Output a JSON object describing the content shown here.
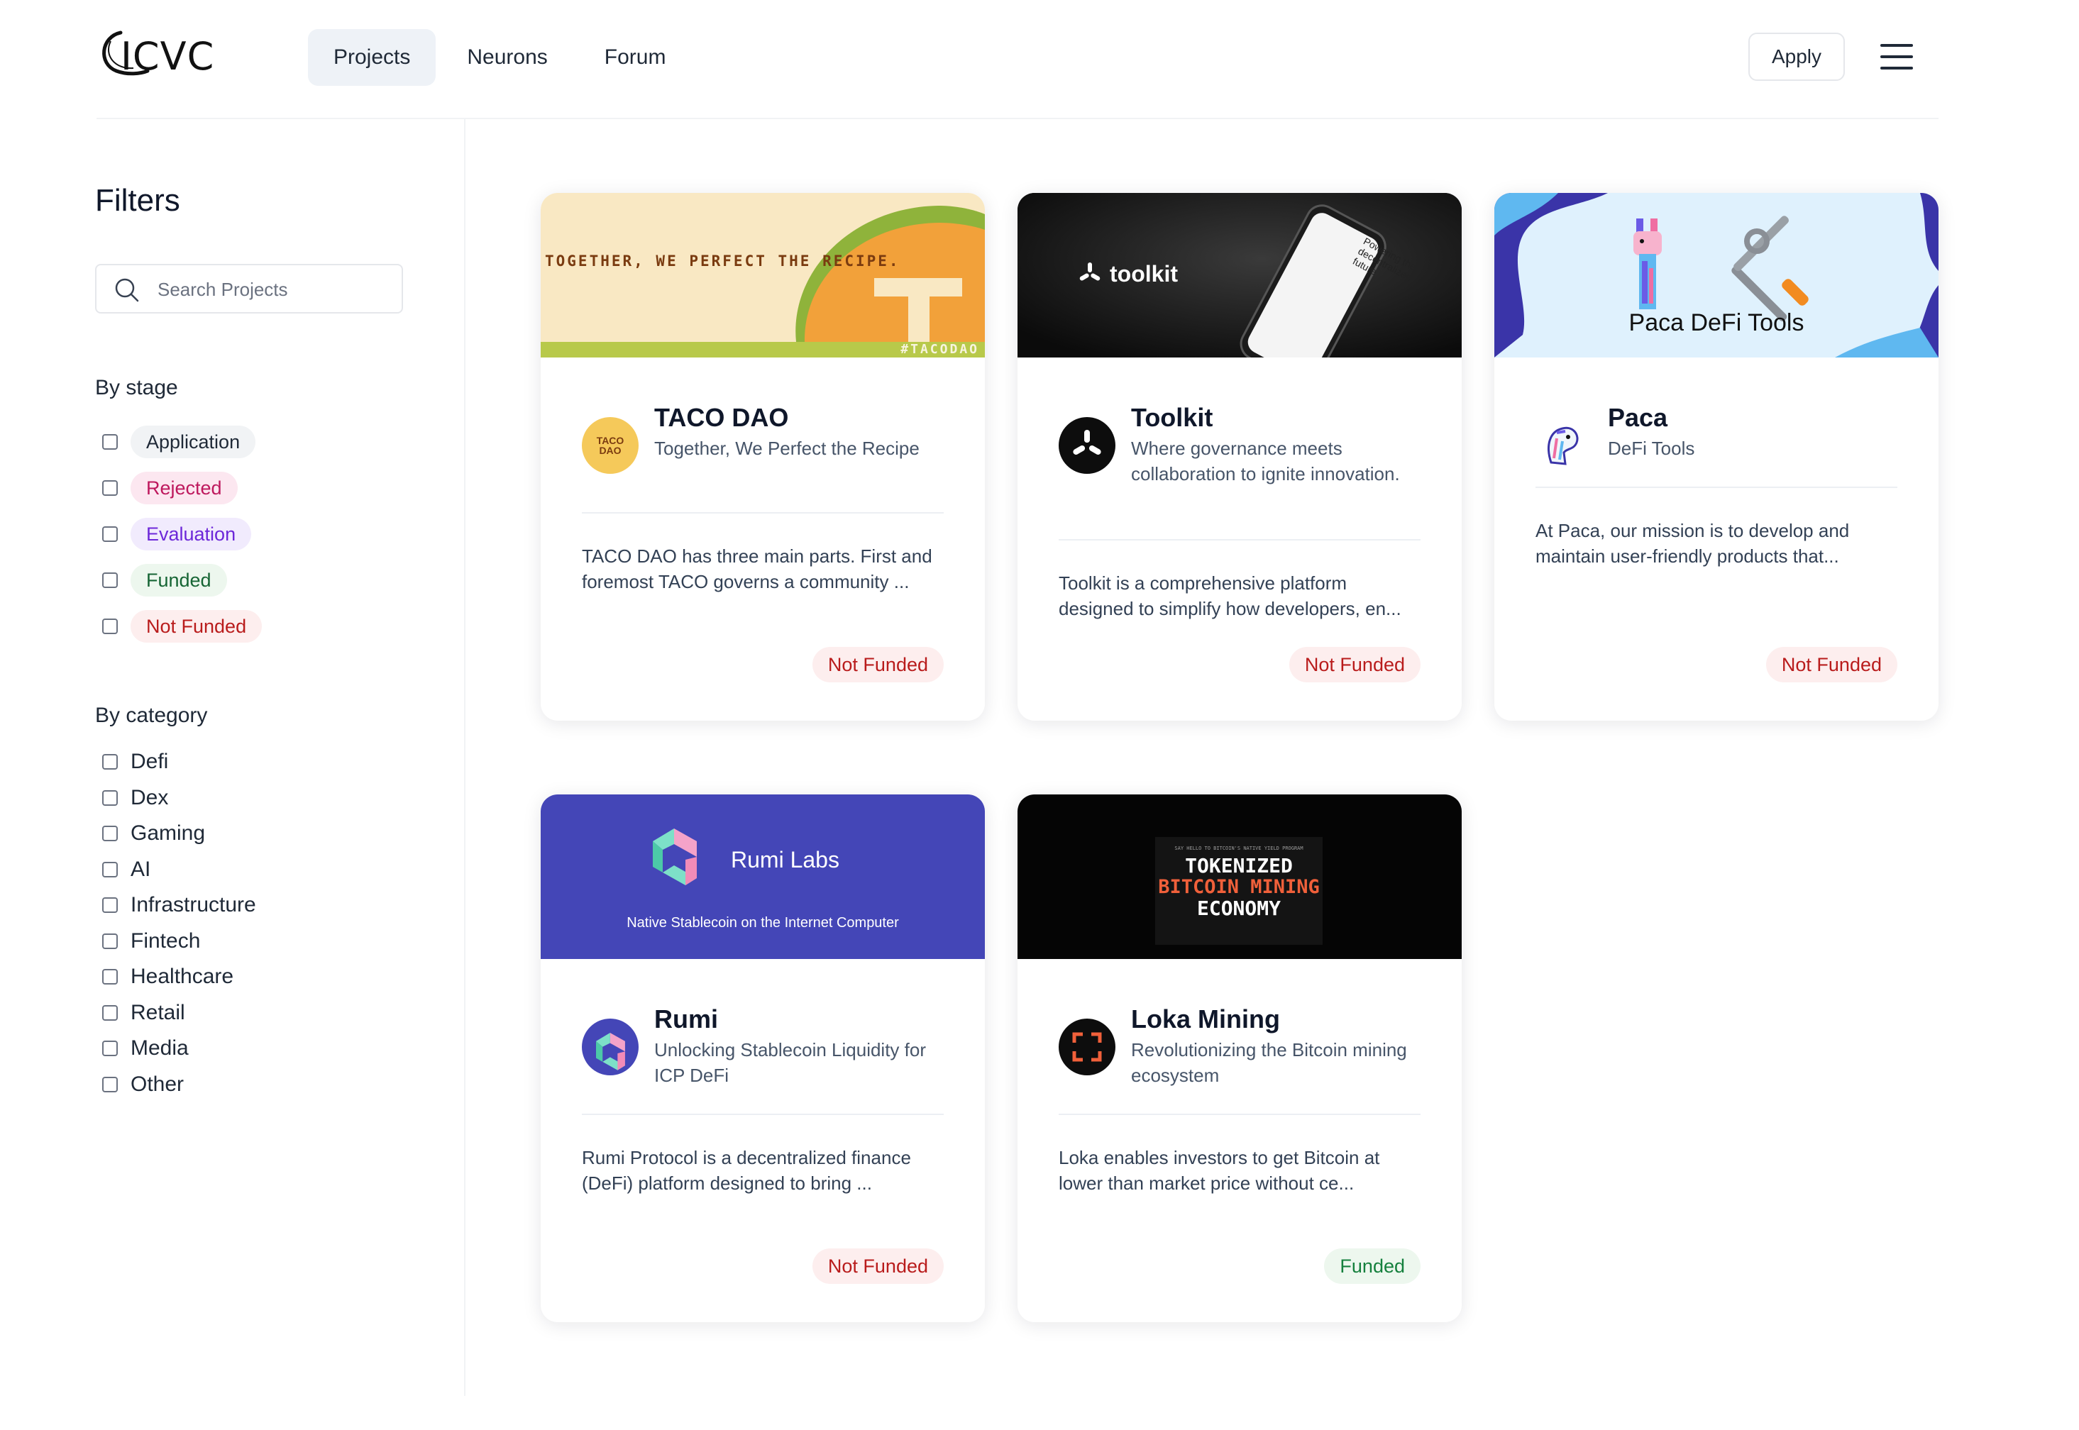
{
  "header": {
    "logo_text": "ICVC",
    "nav": [
      {
        "label": "Projects",
        "active": true
      },
      {
        "label": "Neurons",
        "active": false
      },
      {
        "label": "Forum",
        "active": false
      }
    ],
    "apply_label": "Apply"
  },
  "sidebar": {
    "title": "Filters",
    "search_placeholder": "Search Projects",
    "stage_label": "By stage",
    "stages": [
      {
        "label": "Application",
        "bg": "#f1f3f5",
        "fg": "#1f2937"
      },
      {
        "label": "Rejected",
        "bg": "#fce7f0",
        "fg": "#be185d"
      },
      {
        "label": "Evaluation",
        "bg": "#f1ebfd",
        "fg": "#6d28d9"
      },
      {
        "label": "Funded",
        "bg": "#edf7ee",
        "fg": "#166534"
      },
      {
        "label": "Not Funded",
        "bg": "#fdeeee",
        "fg": "#b91c1c"
      }
    ],
    "category_label": "By category",
    "categories": [
      "Defi",
      "Dex",
      "Gaming",
      "AI",
      "Infrastructure",
      "Fintech",
      "Healthcare",
      "Retail",
      "Media",
      "Other"
    ]
  },
  "projects": [
    {
      "name": "TACO DAO",
      "tagline": "Together, We Perfect the Recipe",
      "description": "TACO DAO has three main parts. First and foremost TACO governs a community ...",
      "status": "Not Funded",
      "banner": {
        "line1": "TOGETHER, WE PERFECT THE RECIPE.",
        "tag": "#TACODAO"
      },
      "logo_text": "TACO DAO"
    },
    {
      "name": "Toolkit",
      "tagline": "Where governance meets collaboration to ignite innovation.",
      "description": "Toolkit is a comprehensive platform designed to simplify how developers, en...",
      "status": "Not Funded",
      "banner": {
        "brand": "toolkit",
        "phone_text": "Powering the decentralized future"
      }
    },
    {
      "name": "Paca",
      "tagline": "DeFi Tools",
      "description": "At Paca, our mission is to develop and maintain user-friendly products that...",
      "status": "Not Funded",
      "banner": {
        "title": "Paca DeFi Tools"
      }
    },
    {
      "name": "Rumi",
      "tagline": "Unlocking Stablecoin Liquidity for ICP DeFi",
      "description": "Rumi Protocol is a decentralized finance (DeFi) platform designed to bring ...",
      "status": "Not Funded",
      "banner": {
        "title": "Rumi Labs",
        "subtitle": "Native Stablecoin on the Internet Computer"
      }
    },
    {
      "name": "Loka Mining",
      "tagline": "Revolutionizing the Bitcoin mining ecosystem",
      "description": "Loka enables investors to get Bitcoin at lower than market price without ce...",
      "status": "Funded",
      "banner": {
        "small": "SAY HELLO TO BITCOIN'S NATIVE YIELD PROGRAM",
        "line1": "TOKENIZED",
        "line2": "BITCOIN MINING",
        "line3": "ECONOMY"
      }
    }
  ],
  "colors": {
    "accent_nav_bg": "#eef2f7",
    "rumi_purple": "#4446b7",
    "taco_cream": "#f9e8c3",
    "paca_sky": "#dff1fd",
    "not_funded_fg": "#b91c1c",
    "funded_fg": "#15803d"
  }
}
